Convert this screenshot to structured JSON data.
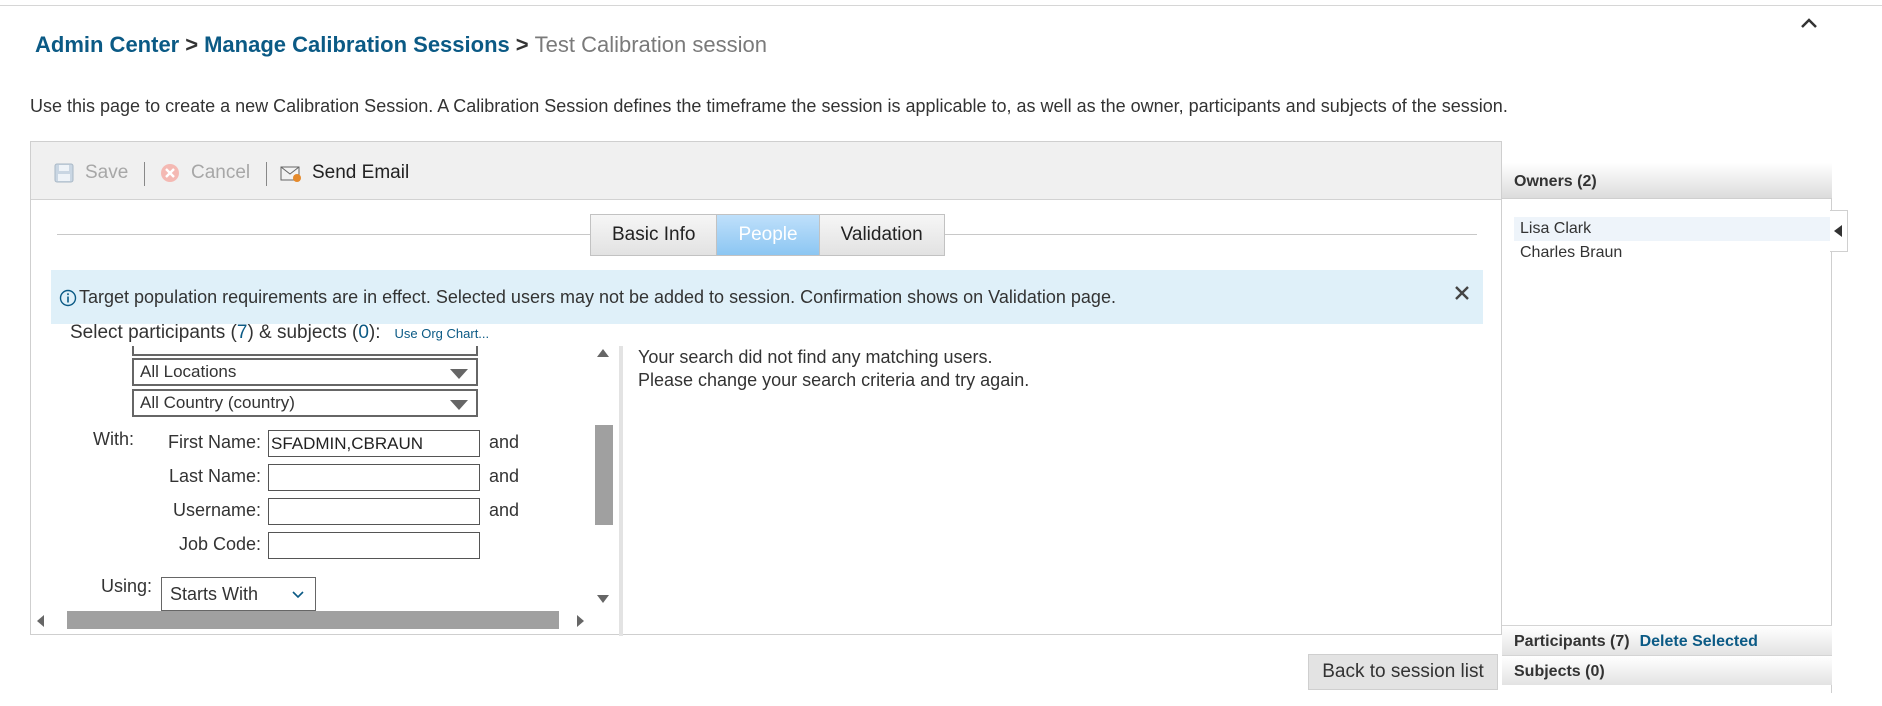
{
  "breadcrumb": {
    "admin_center": "Admin Center",
    "sep1": ">",
    "manage_sessions": "Manage Calibration Sessions",
    "sep2": ">",
    "current": "Test Calibration session"
  },
  "intro": "Use this page to create a new Calibration Session. A Calibration Session defines the timeframe the session is applicable to, as well as the owner, participants and subjects of the session.",
  "toolbar": {
    "save": "Save",
    "cancel": "Cancel",
    "send_email": "Send Email"
  },
  "tabs": [
    {
      "label": "Basic Info",
      "active": false
    },
    {
      "label": "People",
      "active": true
    },
    {
      "label": "Validation",
      "active": false
    }
  ],
  "info": {
    "message": "Target population requirements are in effect. Selected users may not be added to session. Confirmation shows on Validation page."
  },
  "select": {
    "prefix": "Select participants (",
    "participants_count": "7",
    "middle": ") & subjects (",
    "subjects_count": "0",
    "suffix": "):",
    "org_chart_link": "Use Org Chart..."
  },
  "filters": {
    "location": "All Locations",
    "country": "All Country (country)",
    "with_label": "With:",
    "first_name_label": "First Name:",
    "first_name_value": "SFADMIN,CBRAUN",
    "last_name_label": "Last Name:",
    "last_name_value": "",
    "username_label": "Username:",
    "username_value": "",
    "job_code_label": "Job Code:",
    "job_code_value": "",
    "and": "and",
    "using_label": "Using:",
    "using_value": "Starts With"
  },
  "results": {
    "line1": "Your search did not find any matching users.",
    "line2": "Please change your search criteria and try again."
  },
  "back_button": "Back to session list",
  "side": {
    "owners_header": "Owners (2)",
    "owners": [
      "Lisa Clark",
      "Charles Braun"
    ],
    "participants_label": "Participants (7)",
    "delete_selected": "Delete Selected",
    "subjects_label": "Subjects (0)"
  },
  "colors": {
    "link": "#0b5a85",
    "info_bg": "#dff0f9",
    "active_tab": "#8cc6f2"
  }
}
